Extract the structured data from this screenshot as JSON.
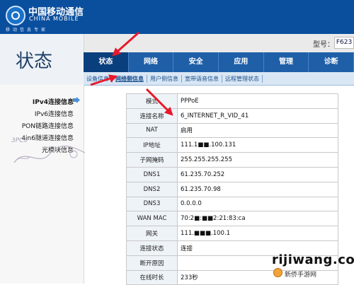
{
  "header": {
    "logo_cn": "中国移动通信",
    "logo_en": "CHINA MOBILE",
    "logo_slogan": "移动信息专家"
  },
  "model": {
    "label": "型号：",
    "value": "F623"
  },
  "status_title": "状态",
  "tabs": [
    {
      "label": "状态",
      "active": true
    },
    {
      "label": "网络",
      "active": false
    },
    {
      "label": "安全",
      "active": false
    },
    {
      "label": "应用",
      "active": false
    },
    {
      "label": "管理",
      "active": false
    },
    {
      "label": "诊断",
      "active": false
    }
  ],
  "subnav": [
    {
      "label": "设备信息",
      "active": false
    },
    {
      "label": "网络侧信息",
      "active": true
    },
    {
      "label": "用户侧信息",
      "active": false
    },
    {
      "label": "宽带语音信息",
      "active": false
    },
    {
      "label": "远程管理状态",
      "active": false
    }
  ],
  "left_menu": [
    {
      "label": "IPv4连接信息",
      "active": true
    },
    {
      "label": "IPv6连接信息",
      "active": false
    },
    {
      "label": "PON链路连接信息",
      "active": false
    },
    {
      "label": "4in6隧道连接信息",
      "active": false
    },
    {
      "label": "光模块信息",
      "active": false
    }
  ],
  "watermark_left": "3PCs",
  "table": [
    {
      "label": "模式",
      "value": "PPPoE"
    },
    {
      "label": "连接名称",
      "value": "6_INTERNET_R_VID_41"
    },
    {
      "label": "NAT",
      "value": "启用"
    },
    {
      "label": "IP地址",
      "value": "111.1■■.100.131"
    },
    {
      "label": "子网掩码",
      "value": "255.255.255.255"
    },
    {
      "label": "DNS1",
      "value": "61.235.70.252"
    },
    {
      "label": "DNS2",
      "value": "61.235.70.98"
    },
    {
      "label": "DNS3",
      "value": "0.0.0.0"
    },
    {
      "label": "WAN MAC",
      "value": "70:2■:■■2:21:83:ca"
    },
    {
      "label": "网关",
      "value": "111.■■■.100.1"
    },
    {
      "label": "连接状态",
      "value": "连接"
    },
    {
      "label": "断开原因",
      "value": ""
    },
    {
      "label": "在线时长",
      "value": "233秒"
    }
  ],
  "watermark_right": {
    "text": "rijiwang.com",
    "sub": "新侨手游网"
  },
  "colors": {
    "header": "#0a4f9e",
    "tab_bar": "#1f5fa8",
    "tab_active": "#0a3f7d",
    "arrow": "#e8192c"
  }
}
